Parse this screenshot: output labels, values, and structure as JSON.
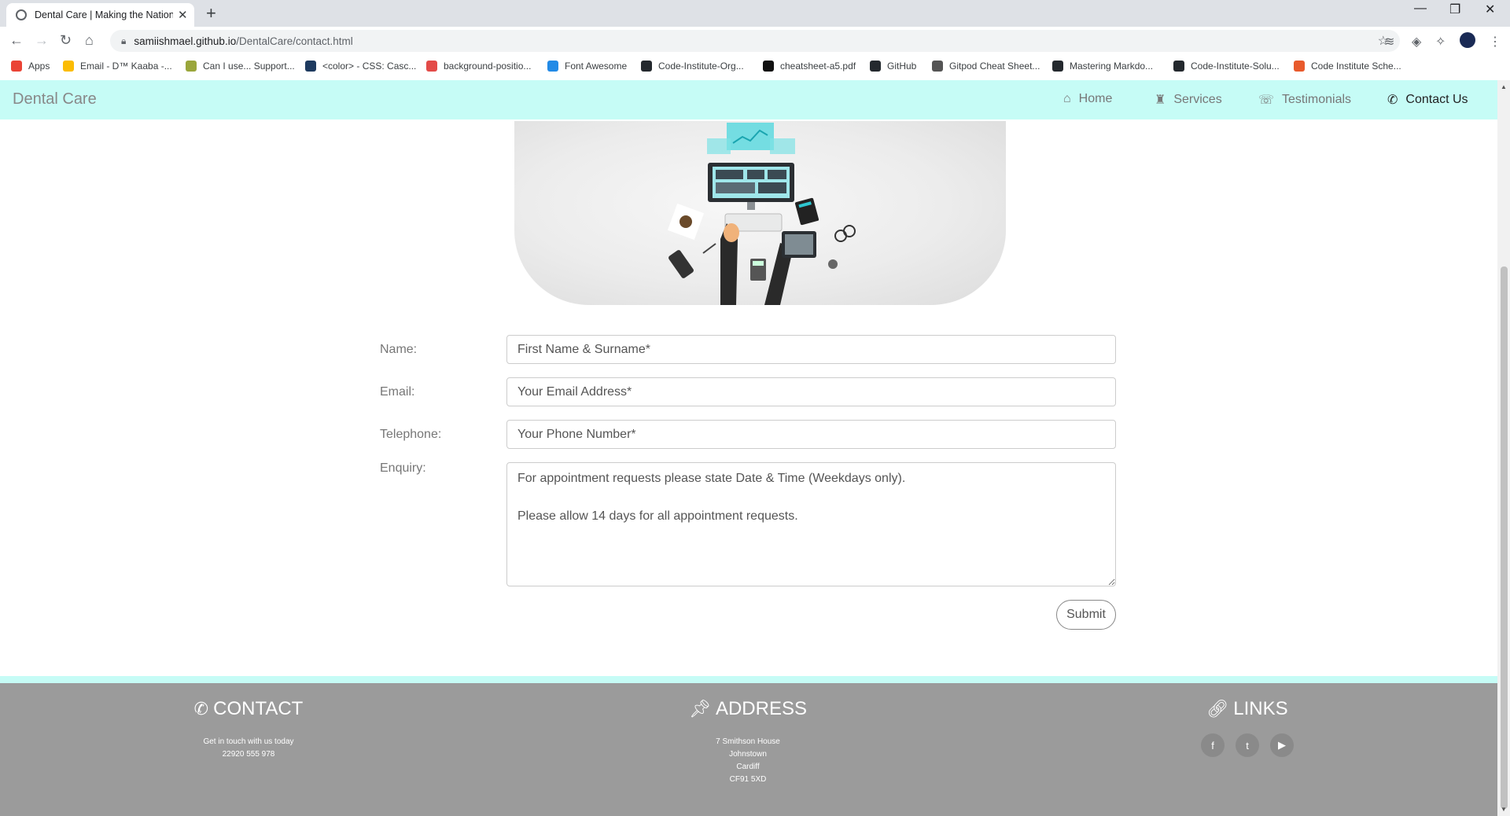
{
  "browser": {
    "tab_title": "Dental Care | Making the Nation",
    "new_tab": "+",
    "url_host": "samiishmael.github.io",
    "url_path": "/DentalCare/contact.html",
    "bookmarks": [
      {
        "label": "Apps",
        "color": "#ea4335"
      },
      {
        "label": "Email - D™ Kaaba -...",
        "color": "#fbbc04"
      },
      {
        "label": "Can I use... Support...",
        "color": "#9aa63b"
      },
      {
        "label": "<color> - CSS: Casc...",
        "color": "#1e3a5f"
      },
      {
        "label": "background-positio...",
        "color": "#e34b48"
      },
      {
        "label": "Font Awesome",
        "color": "#228ae6"
      },
      {
        "label": "Code-Institute-Org...",
        "color": "#24292e"
      },
      {
        "label": "cheatsheet-a5.pdf",
        "color": "#111111"
      },
      {
        "label": "GitHub",
        "color": "#24292e"
      },
      {
        "label": "Gitpod Cheat Sheet...",
        "color": "#555555"
      },
      {
        "label": "Mastering Markdo...",
        "color": "#24292e"
      },
      {
        "label": "Code-Institute-Solu...",
        "color": "#24292e"
      },
      {
        "label": "Code Institute Sche...",
        "color": "#e85a2c"
      }
    ]
  },
  "nav": {
    "brand": "Dental Care",
    "links": [
      {
        "label": "Home",
        "icon": "home-icon",
        "glyph": "⌂"
      },
      {
        "label": "Services",
        "icon": "tooth-icon",
        "glyph": "♜"
      },
      {
        "label": "Testimonials",
        "icon": "comments-icon",
        "glyph": "☏"
      },
      {
        "label": "Contact Us",
        "icon": "phone-icon",
        "glyph": "✆"
      }
    ],
    "active": "Contact Us",
    "colors": {
      "background": "#c6fcf6",
      "text": "#777777",
      "active_text": "#222222"
    }
  },
  "form": {
    "name_label": "Name:",
    "name_placeholder": "First Name & Surname*",
    "email_label": "Email:",
    "email_placeholder": "Your Email Address*",
    "phone_label": "Telephone:",
    "phone_placeholder": "Your Phone Number*",
    "enquiry_label": "Enquiry:",
    "enquiry_text": "For appointment requests please state Date & Time (Weekdays only).\n\nPlease allow 14 days for all appointment requests.",
    "submit_label": "Submit"
  },
  "footer": {
    "contact": {
      "title": "CONTACT",
      "lines": [
        "Get in touch with us today",
        "22920 555 978"
      ]
    },
    "address": {
      "title": "ADDRESS",
      "lines": [
        "7 Smithson House",
        "Johnstown",
        "Cardiff",
        "CF91 5XD"
      ]
    },
    "links": {
      "title": "LINKS",
      "socials": [
        {
          "icon": "facebook-icon",
          "glyph": "f"
        },
        {
          "icon": "twitter-icon",
          "glyph": "t"
        },
        {
          "icon": "youtube-icon",
          "glyph": "▶"
        }
      ]
    },
    "colors": {
      "background": "#9b9b9b",
      "accent": "#c6fcf6"
    }
  }
}
